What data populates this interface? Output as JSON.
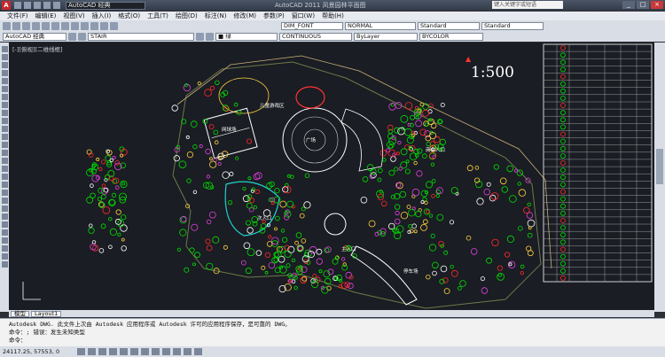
{
  "titlebar": {
    "workspace": "AutoCAD 经典",
    "title": "AutoCAD 2011    风景园林平面图",
    "search_placeholder": "键入关键字或短语"
  },
  "menubar": {
    "items": [
      "文件(F)",
      "编辑(E)",
      "视图(V)",
      "插入(I)",
      "格式(O)",
      "工具(T)",
      "绘图(D)",
      "标注(N)",
      "修改(M)",
      "参数(P)",
      "窗口(W)",
      "帮助(H)"
    ]
  },
  "toolbar1": {
    "text_style": "DIM_FONT",
    "dim_style": "NORMAL",
    "table_style": "Standard",
    "multileader_style": "Standard"
  },
  "toolbar2": {
    "workspace": "AutoCAD 经典",
    "layer": "STAIR",
    "color": "■ 绿",
    "linetype": "CONTINUOUS",
    "lineweight": "ByLayer",
    "plot_style": "BYCOLOR"
  },
  "viewport": {
    "label": "[-][俯视][二维线框]",
    "scale": "1:500",
    "labels": [
      "儿童游戏区",
      "网球场",
      "广场",
      "停车场",
      "商业入口",
      "主入口",
      "次入口"
    ]
  },
  "tabs": [
    "模型",
    "Layout1"
  ],
  "command": {
    "line1": "Autodesk DWG.  此文件上次由 Autodesk 应用程序或 Autodesk 许可的应用程序保存，是可靠的 DWG。",
    "line2": "命令：; 错误：发生未知类型",
    "line3": "命令："
  },
  "status": {
    "coords": "24117.25, 57553, 0"
  },
  "colors": {
    "accent": "#00ff00",
    "background": "#1a1d23",
    "tree_red": "#ff2a2a",
    "tree_green": "#00e000"
  },
  "plant_table": {
    "rows": 33
  }
}
